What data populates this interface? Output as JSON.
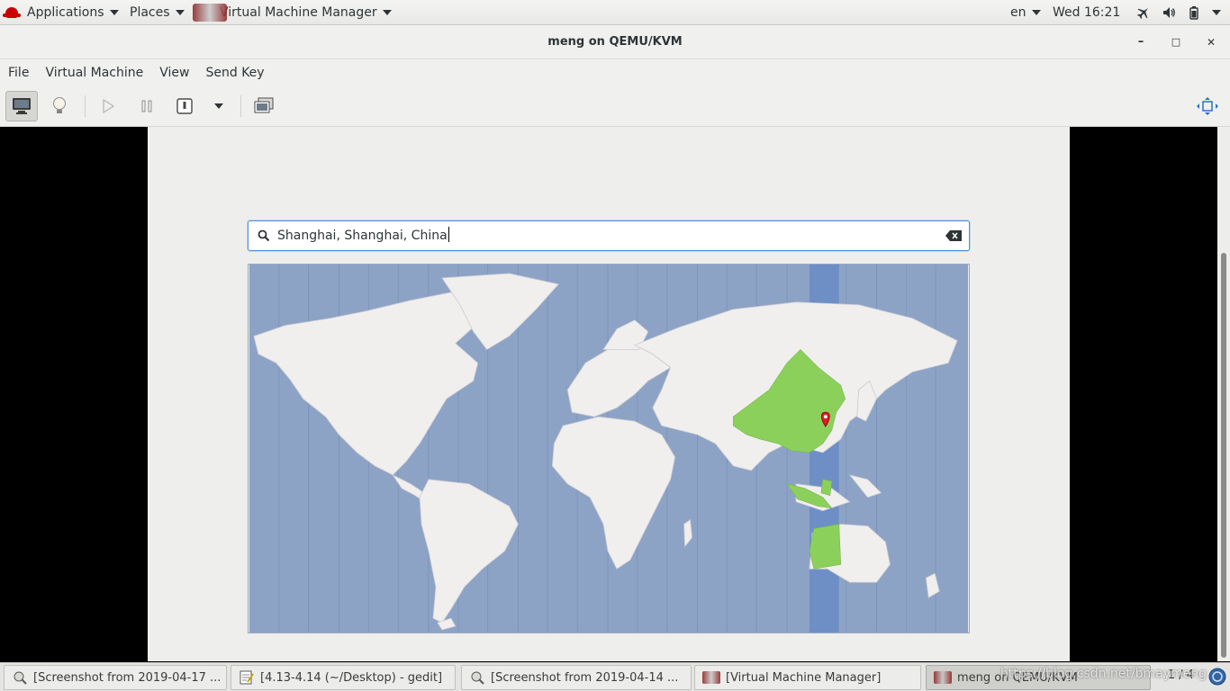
{
  "topbar": {
    "applications": "Applications",
    "places": "Places",
    "app_name": "Virtual Machine Manager",
    "lang": "en",
    "clock": "Wed 16:21"
  },
  "window": {
    "title": "meng on QEMU/KVM",
    "minimize": "–",
    "maximize": "□",
    "close": "✕"
  },
  "menubar": [
    "File",
    "Virtual Machine",
    "View",
    "Send Key"
  ],
  "toolbar": {
    "icons": [
      "monitor-icon",
      "lightbulb-icon",
      "play-icon",
      "pause-icon",
      "power-icon",
      "dropdown-icon",
      "screenshot-icon",
      "fullscreen-icon"
    ]
  },
  "guest": {
    "search_value": "Shanghai, Shanghai, China",
    "selected_region_color": "#8cd05c",
    "ocean_color": "#8da3c6",
    "land_color": "#f0efee",
    "highlight_band_color": "#6d8fc6",
    "pin_color": "#e01b24"
  },
  "taskbar": {
    "items": [
      "[Screenshot from 2019-04-17 ...",
      "[4.13-4.14 (~/Desktop) - gedit]",
      "[Screenshot from 2019-04-14 ...",
      "[Virtual Machine Manager]",
      "meng on QEMU/KVM"
    ],
    "pager": "1 / 4",
    "watermark": "https://blog.csdn.net/bmaymeng"
  }
}
